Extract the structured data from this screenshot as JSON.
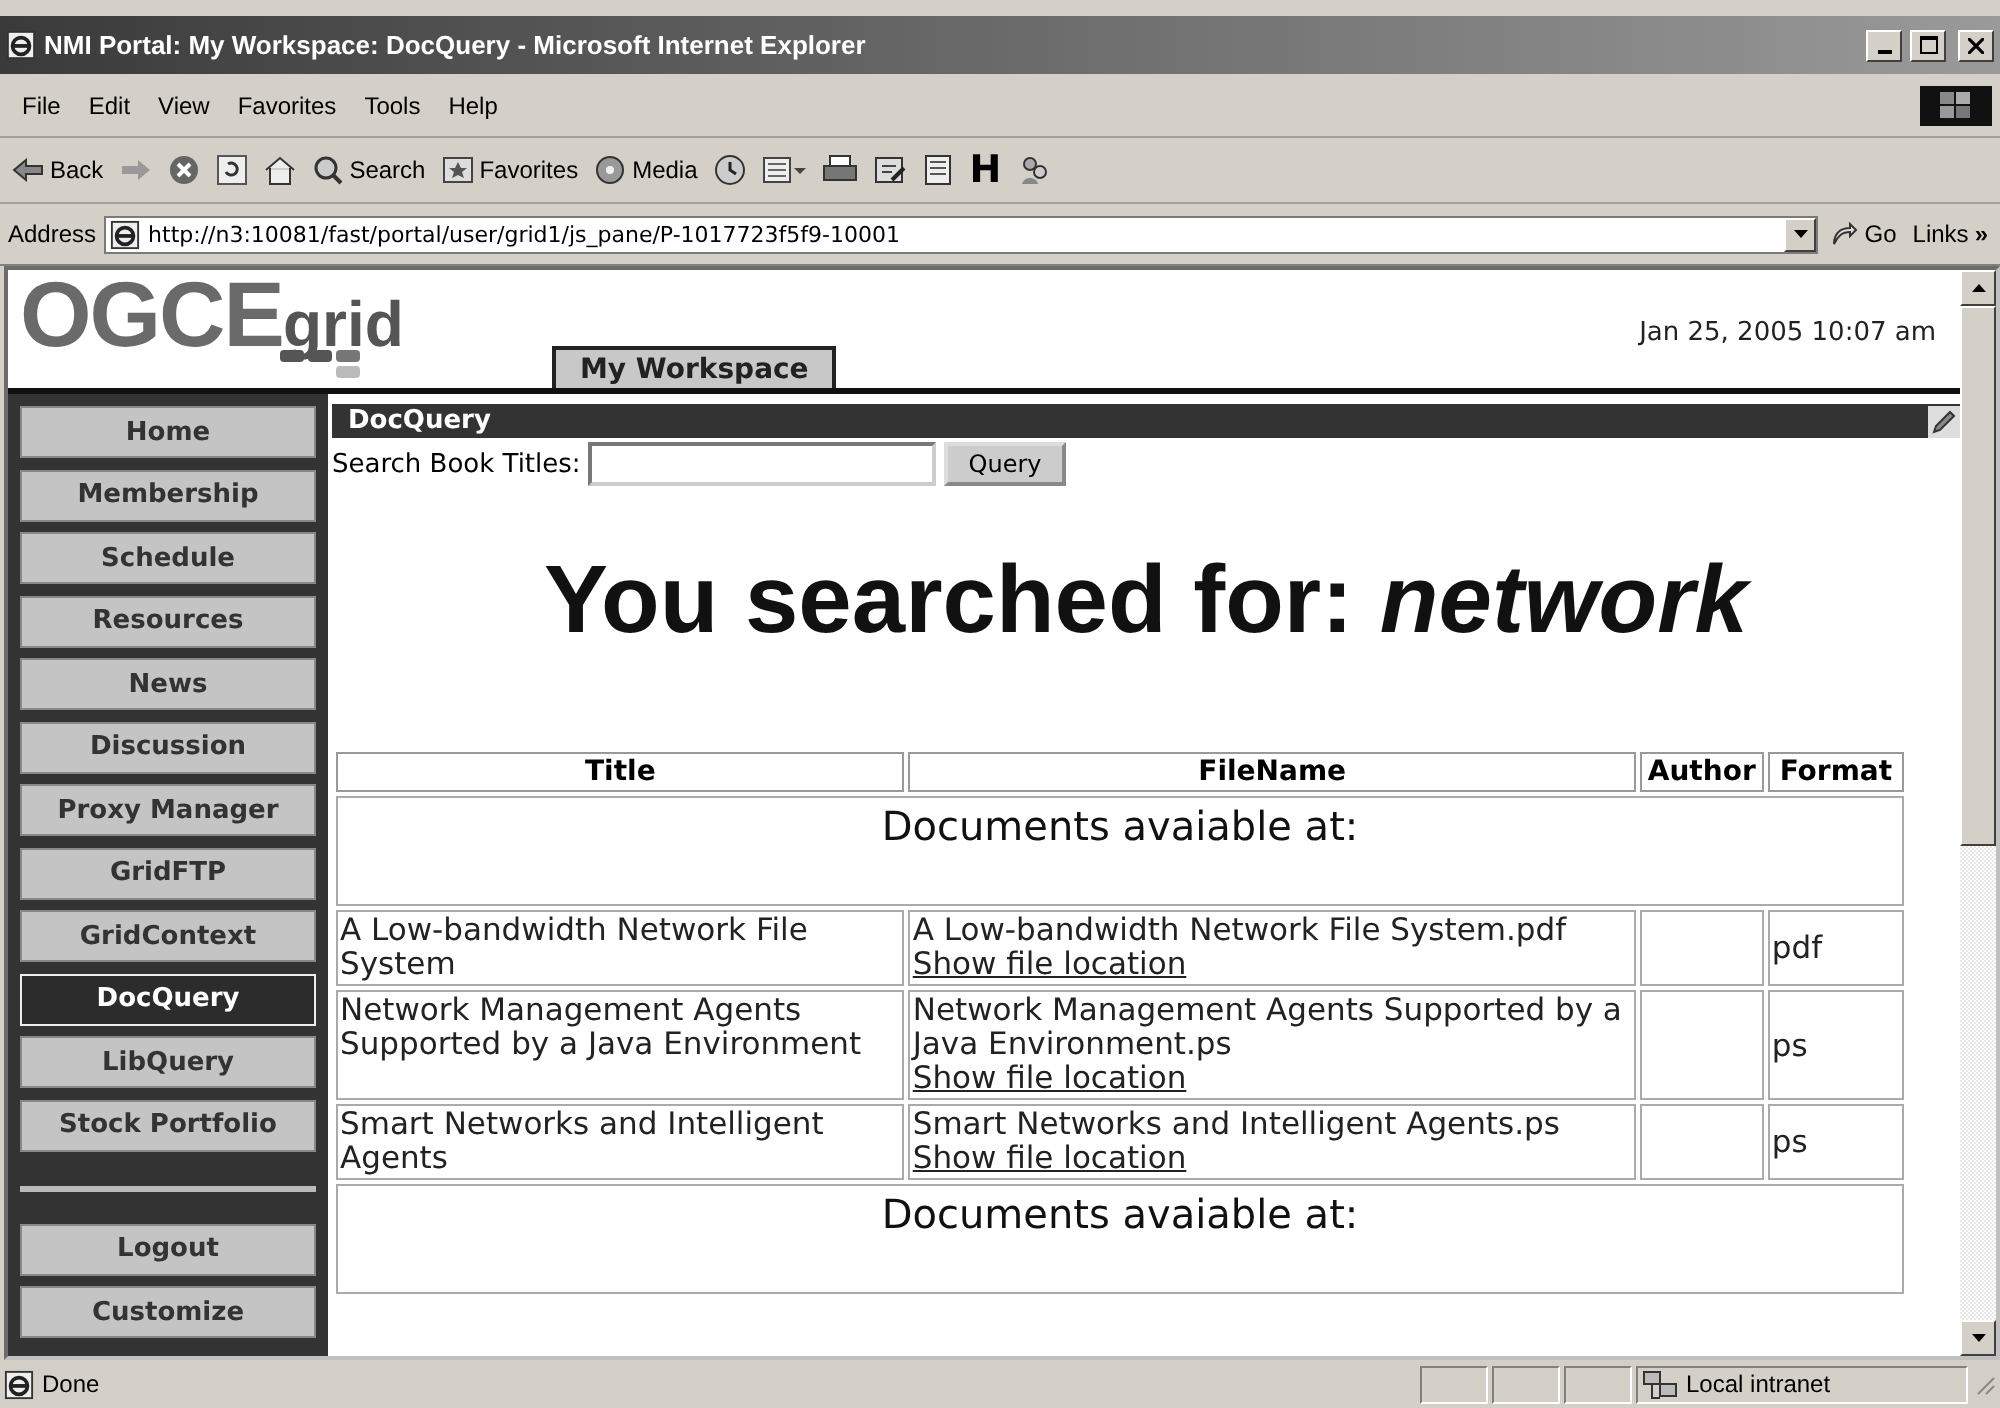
{
  "window": {
    "title": "NMI Portal: My Workspace: DocQuery - Microsoft Internet Explorer"
  },
  "menu": [
    "File",
    "Edit",
    "View",
    "Favorites",
    "Tools",
    "Help"
  ],
  "toolbar": [
    {
      "kind": "back",
      "label": "Back"
    },
    {
      "kind": "forward"
    },
    {
      "kind": "stop"
    },
    {
      "kind": "refresh"
    },
    {
      "kind": "home"
    },
    {
      "kind": "search",
      "label": "Search"
    },
    {
      "kind": "favorites",
      "label": "Favorites"
    },
    {
      "kind": "media",
      "label": "Media"
    },
    {
      "kind": "history"
    },
    {
      "kind": "mail"
    },
    {
      "kind": "print"
    },
    {
      "kind": "edit"
    },
    {
      "kind": "discuss"
    },
    {
      "kind": "letter",
      "label": "H"
    },
    {
      "kind": "messenger"
    }
  ],
  "address": {
    "label": "Address",
    "value": "http://n3:10081/fast/portal/user/grid1/js_pane/P-1017723f5f9-10001",
    "go": "Go",
    "links": "Links",
    "more": "»"
  },
  "portal": {
    "logo": {
      "main": "OGCE",
      "sub": "grid"
    },
    "tabs": [
      {
        "label": "My Workspace",
        "selected": true
      }
    ],
    "date": "Jan 25, 2005 10:07 am"
  },
  "sidebar": {
    "items": [
      {
        "label": "Home",
        "selected": false
      },
      {
        "label": "Membership",
        "selected": false
      },
      {
        "label": "Schedule",
        "selected": false
      },
      {
        "label": "Resources",
        "selected": false
      },
      {
        "label": "News",
        "selected": false
      },
      {
        "label": "Discussion",
        "selected": false
      },
      {
        "label": "Proxy Manager",
        "selected": false
      },
      {
        "label": "GridFTP",
        "selected": false
      },
      {
        "label": "GridContext",
        "selected": false
      },
      {
        "label": "DocQuery",
        "selected": true
      },
      {
        "label": "LibQuery",
        "selected": false
      },
      {
        "label": "Stock Portfolio",
        "selected": false
      }
    ],
    "bottom_items": [
      "Logout",
      "Customize"
    ]
  },
  "portlet": {
    "title": "DocQuery",
    "search_label": "Search Book Titles:",
    "button": "Query",
    "heading": "You searched for: *network*"
  },
  "table": {
    "columns": [
      "Title",
      "FileName",
      "Author",
      "Format"
    ],
    "rows": [
      {
        "kind": "group",
        "text": "Documents avaiable at:"
      },
      {
        "kind": "document",
        "title": "A Low-bandwidth Network File System",
        "file_name": "A Low-bandwidth Network File System.pdf",
        "link": "Show file location",
        "format": "pdf"
      },
      {
        "kind": "document",
        "title": "Network Management Agents Supported by a Java Environment",
        "file_name": "Network Management Agents Supported by a Java Environment.ps",
        "link": "Show file location",
        "format": "ps"
      },
      {
        "kind": "document",
        "title": "Smart Networks and Intelligent Agents",
        "file_name": "Smart Networks and Intelligent Agents.ps",
        "link": "Show file location",
        "format": "ps"
      },
      {
        "kind": "group",
        "text": "Documents avaiable at:"
      }
    ]
  },
  "status_bar": {
    "text": "Done",
    "zone": "Local intranet"
  }
}
